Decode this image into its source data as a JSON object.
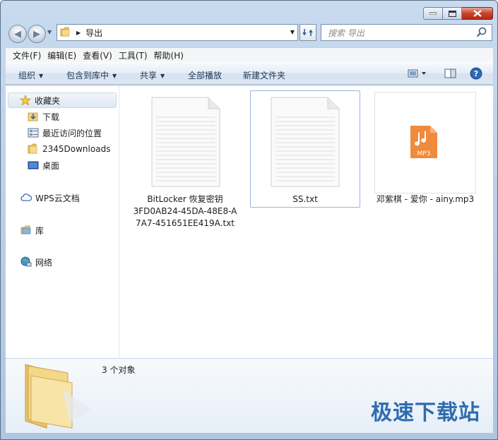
{
  "window": {
    "controls": {
      "minimize": "minimize",
      "maximize": "maximize",
      "close": "close"
    }
  },
  "address": {
    "path": "导出"
  },
  "search": {
    "placeholder": "搜索 导出"
  },
  "menubar": {
    "items": [
      "文件(F)",
      "编辑(E)",
      "查看(V)",
      "工具(T)",
      "帮助(H)"
    ]
  },
  "toolbar": {
    "organize": "组织",
    "include_in_library": "包含到库中",
    "share": "共享",
    "play_all": "全部播放",
    "new_folder": "新建文件夹"
  },
  "navpane": {
    "favorites": "收藏夹",
    "fav_items": [
      "下载",
      "最近访问的位置",
      "2345Downloads",
      "桌面"
    ],
    "wps": "WPS云文档",
    "library": "库",
    "network": "网络"
  },
  "files": [
    {
      "name_lines": [
        "BitLocker 恢复密钥",
        "3FD0AB24-45DA-48E8-A",
        "7A7-451651EE419A.txt"
      ],
      "type": "txt",
      "selected": false
    },
    {
      "name_lines": [
        "SS.txt"
      ],
      "type": "txt",
      "selected": true
    },
    {
      "name_lines": [
        "邓紫棋 - 爱你 - ainy.mp3"
      ],
      "type": "mp3",
      "badge": "MP3",
      "selected": false
    }
  ],
  "details": {
    "count": "3 个对象"
  },
  "watermark": "极速下载站",
  "colors": {
    "window_frame": "#b7cde6",
    "mp3_orange": "#f08a3c",
    "watermark_blue": "#1b5ea8",
    "selection_border": "#99b7d9"
  }
}
